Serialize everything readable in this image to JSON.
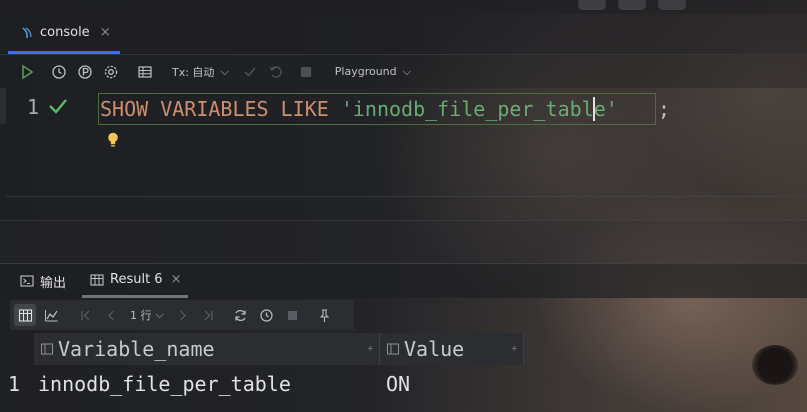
{
  "console_tab": {
    "label": "console",
    "close": "×"
  },
  "toolbar": {
    "tx_label": "Tx: 自动",
    "tx_chevron": "⌵",
    "playground_label": "Playground",
    "playground_chevron": "⌵"
  },
  "editor": {
    "line_number": "1",
    "keyword_text": "SHOW VARIABLES LIKE ",
    "string_text": "'innodb_file_per_table'",
    "terminator": ";"
  },
  "result_tabs": {
    "output_label": "输出",
    "result_label": "Result 6",
    "result_close": "×"
  },
  "grid_toolbar": {
    "page_size_label": "1 行",
    "page_size_chevron": "⌵"
  },
  "table": {
    "columns": [
      "Variable_name",
      "Value"
    ],
    "sort_glyph": "÷",
    "rows": [
      {
        "num": "1",
        "cells": [
          "innodb_file_per_table",
          "ON"
        ]
      }
    ]
  },
  "colors": {
    "accent_blue": "#3574f0",
    "keyword": "#cf8e6d",
    "string": "#6aab73",
    "success_check": "#5fb865",
    "run_green": "#57965c",
    "bulb_yellow": "#f2c55c"
  }
}
